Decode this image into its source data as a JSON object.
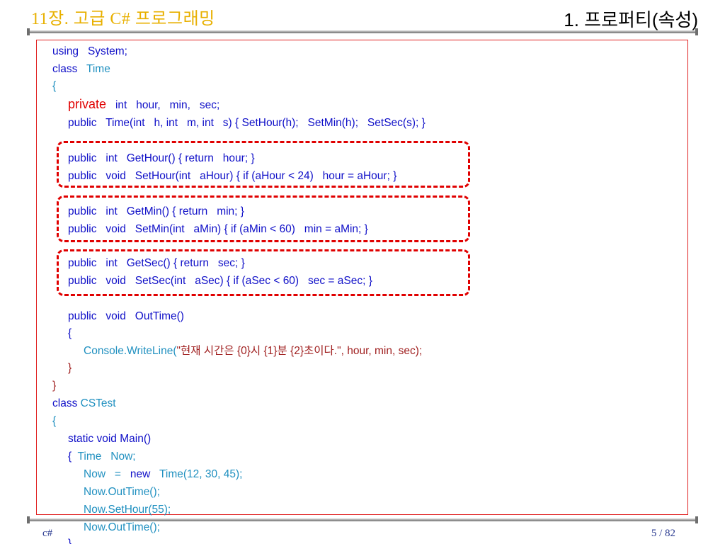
{
  "header": {
    "chapter_title": "11장. 고급 C# 프로그래밍",
    "section_title": "1. 프로퍼티(속성)"
  },
  "code": {
    "l1": "using   System;",
    "l2a": "class   ",
    "l2b": "Time",
    "l3": "{",
    "l4a": "private",
    "l4b": "   int   hour,   min,   sec;",
    "l5": "public   Time(int   h, int   m, int   s) { SetHour(h);   SetMin(h);   SetSec(s); }",
    "l6": "public   int   GetHour() { return   hour; }",
    "l7": "public   void   SetHour(int   aHour) { if (aHour < 24)   hour = aHour; }",
    "l8": "public   int   GetMin() { return   min; }",
    "l9": "public   void   SetMin(int   aMin) { if (aMin < 60)   min = aMin; }",
    "l10": "public   int   GetSec() { return   sec; }",
    "l11": "public   void   SetSec(int   aSec) { if (aSec < 60)   sec = aSec; }",
    "l12": "public   void   OutTime()",
    "l13": "{",
    "l14a": "Console.WriteLine(",
    "l14b": "\"현재 시간은 {0}시 {1}분 {2}초이다.\", hour, min, sec);",
    "l15": "}",
    "l16": "}",
    "l17a": "class ",
    "l17b": "CSTest",
    "l18": "{",
    "l19": "static void Main()",
    "l20a": "{  ",
    "l20b": "Time   Now;",
    "l21a": "Now   =   ",
    "l21b": "new",
    "l21c": "   Time(12, 30, 45);",
    "l22": "Now.OutTime();",
    "l23": "Now.SetHour(55);",
    "l24": "Now.OutTime();",
    "l25": "}"
  },
  "footer": {
    "left": "c#",
    "page": "5 / 82"
  },
  "colors": {
    "keyword": "#1010c8",
    "highlight_keyword": "#e00000",
    "type_name": "#2090c0",
    "string": "#a02020",
    "title_accent": "#e8b000"
  }
}
